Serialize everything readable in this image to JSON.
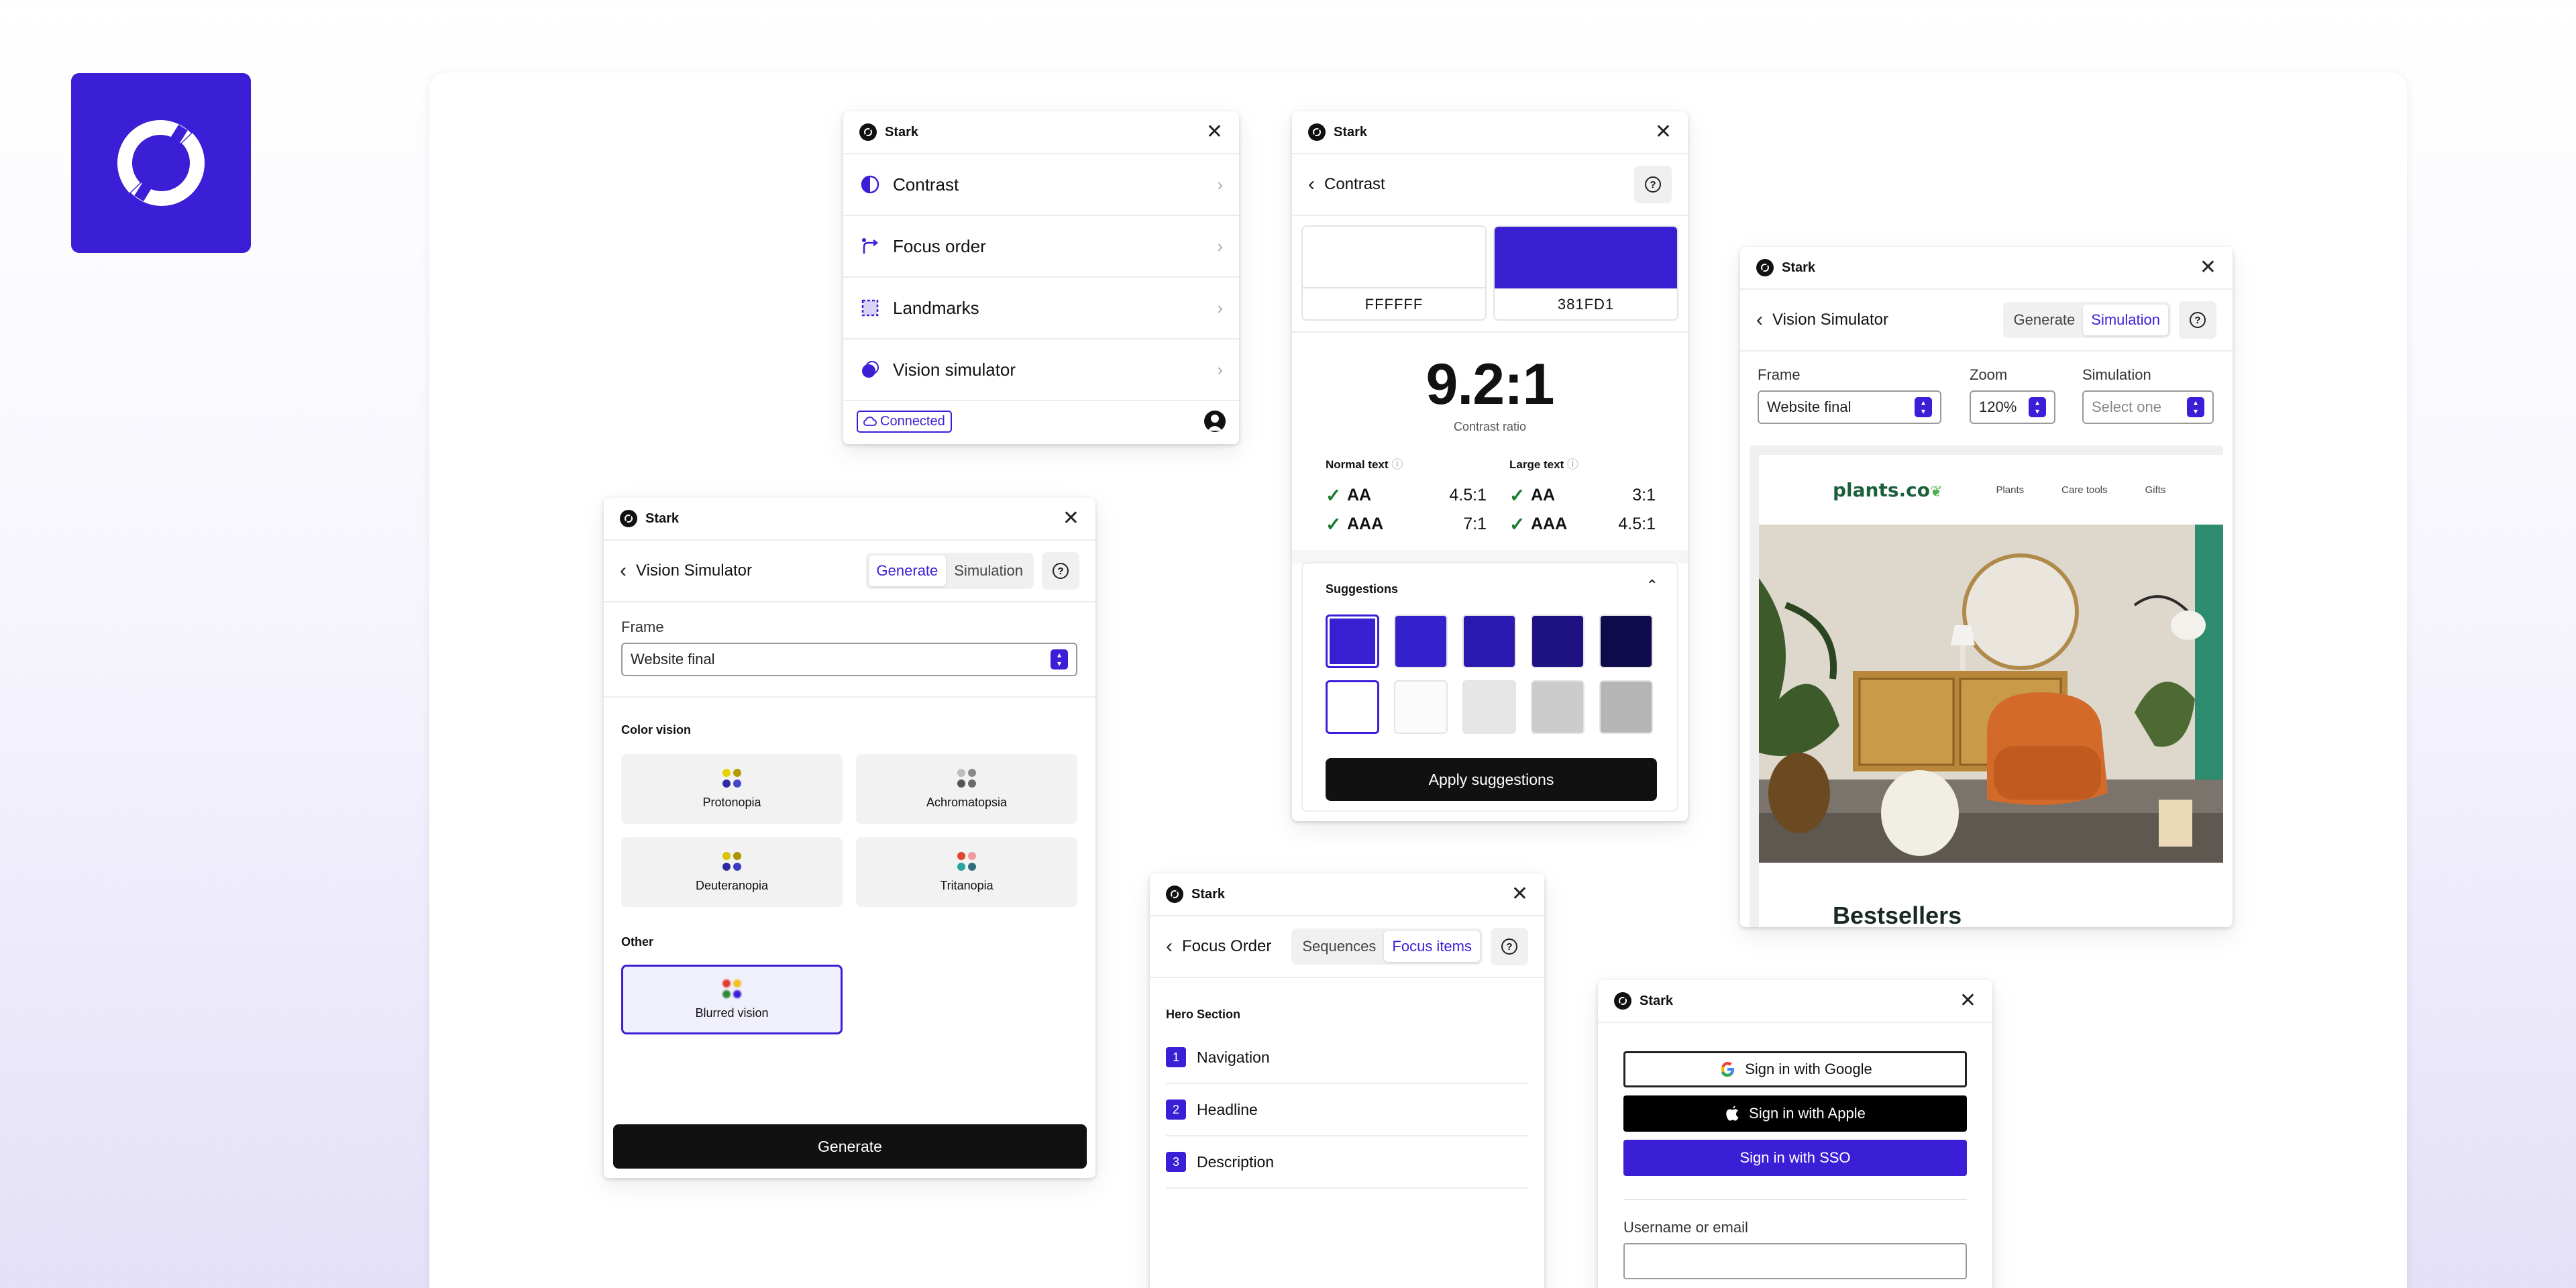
{
  "app_name": "Stark",
  "colors": {
    "brand": "#3a1fd6",
    "black": "#111111",
    "green": "#1a7a2e"
  },
  "menu": {
    "items": [
      {
        "label": "Contrast",
        "icon": "contrast-icon"
      },
      {
        "label": "Focus order",
        "icon": "focus-order-icon"
      },
      {
        "label": "Landmarks",
        "icon": "landmarks-icon"
      },
      {
        "label": "Vision simulator",
        "icon": "vision-simulator-icon"
      }
    ],
    "status": "Connected"
  },
  "contrast": {
    "title": "Contrast",
    "fg": {
      "hex": "FFFFFF",
      "color": "#ffffff"
    },
    "bg": {
      "hex": "381FD1",
      "color": "#381fd1"
    },
    "ratio": "9.2:1",
    "ratio_label": "Contrast ratio",
    "normal_text": {
      "label": "Normal text",
      "rows": [
        {
          "level": "AA",
          "value": "4.5:1"
        },
        {
          "level": "AAA",
          "value": "7:1"
        }
      ]
    },
    "large_text": {
      "label": "Large text",
      "rows": [
        {
          "level": "AA",
          "value": "3:1"
        },
        {
          "level": "AAA",
          "value": "4.5:1"
        }
      ]
    },
    "suggestions_label": "Suggestions",
    "suggestions_row1": [
      "#381fd1",
      "#3421cc",
      "#2a19b0",
      "#1e1283",
      "#0f0a4a"
    ],
    "suggestions_row2": [
      "#ffffff",
      "#fbfbfb",
      "#e6e6e6",
      "#cccccc",
      "#b5b5b5"
    ],
    "apply_label": "Apply suggestions"
  },
  "vision_large": {
    "title": "Vision Simulator",
    "tabs": [
      "Generate",
      "Simulation"
    ],
    "frame_label": "Frame",
    "frame_value": "Website final",
    "color_vision_label": "Color vision",
    "color_vision": [
      {
        "label": "Protonopia",
        "dots": [
          "#e8d400",
          "#b39a00",
          "#2f2aa6",
          "#4a46c9"
        ]
      },
      {
        "label": "Achromatopsia",
        "dots": [
          "#bdbdbd",
          "#8a8a8a",
          "#555555",
          "#6a6a6a"
        ]
      },
      {
        "label": "Deuteranopia",
        "dots": [
          "#d9c200",
          "#a89500",
          "#2c2c9e",
          "#3b3bbf"
        ]
      },
      {
        "label": "Tritanopia",
        "dots": [
          "#e0462b",
          "#f39a9a",
          "#2aa3a0",
          "#2e6f7a"
        ]
      }
    ],
    "other_label": "Other",
    "other": [
      {
        "label": "Blurred vision",
        "dots": [
          "#e23a2a",
          "#f0c020",
          "#2f8a3a",
          "#3a1fd6"
        ]
      }
    ],
    "generate_label": "Generate"
  },
  "focus_order": {
    "title": "Focus Order",
    "tabs": [
      "Sequences",
      "Focus items"
    ],
    "section_label": "Hero Section",
    "items": [
      {
        "num": "1",
        "label": "Navigation"
      },
      {
        "num": "2",
        "label": "Headline"
      },
      {
        "num": "3",
        "label": "Description"
      }
    ]
  },
  "vision_sim": {
    "title": "Vision Simulator",
    "tabs": [
      "Generate",
      "Simulation"
    ],
    "frame_label": "Frame",
    "frame_value": "Website final",
    "zoom_label": "Zoom",
    "zoom_value": "120%",
    "simulation_label": "Simulation",
    "simulation_placeholder": "Select one",
    "preview": {
      "logo": "plants.co",
      "nav": [
        "Plants",
        "Care tools",
        "Gifts"
      ],
      "heading": "Bestsellers"
    }
  },
  "signin": {
    "google_label": "Sign in with Google",
    "apple_label": "Sign in with Apple",
    "sso_label": "Sign in with SSO",
    "username_label": "Username or email"
  }
}
